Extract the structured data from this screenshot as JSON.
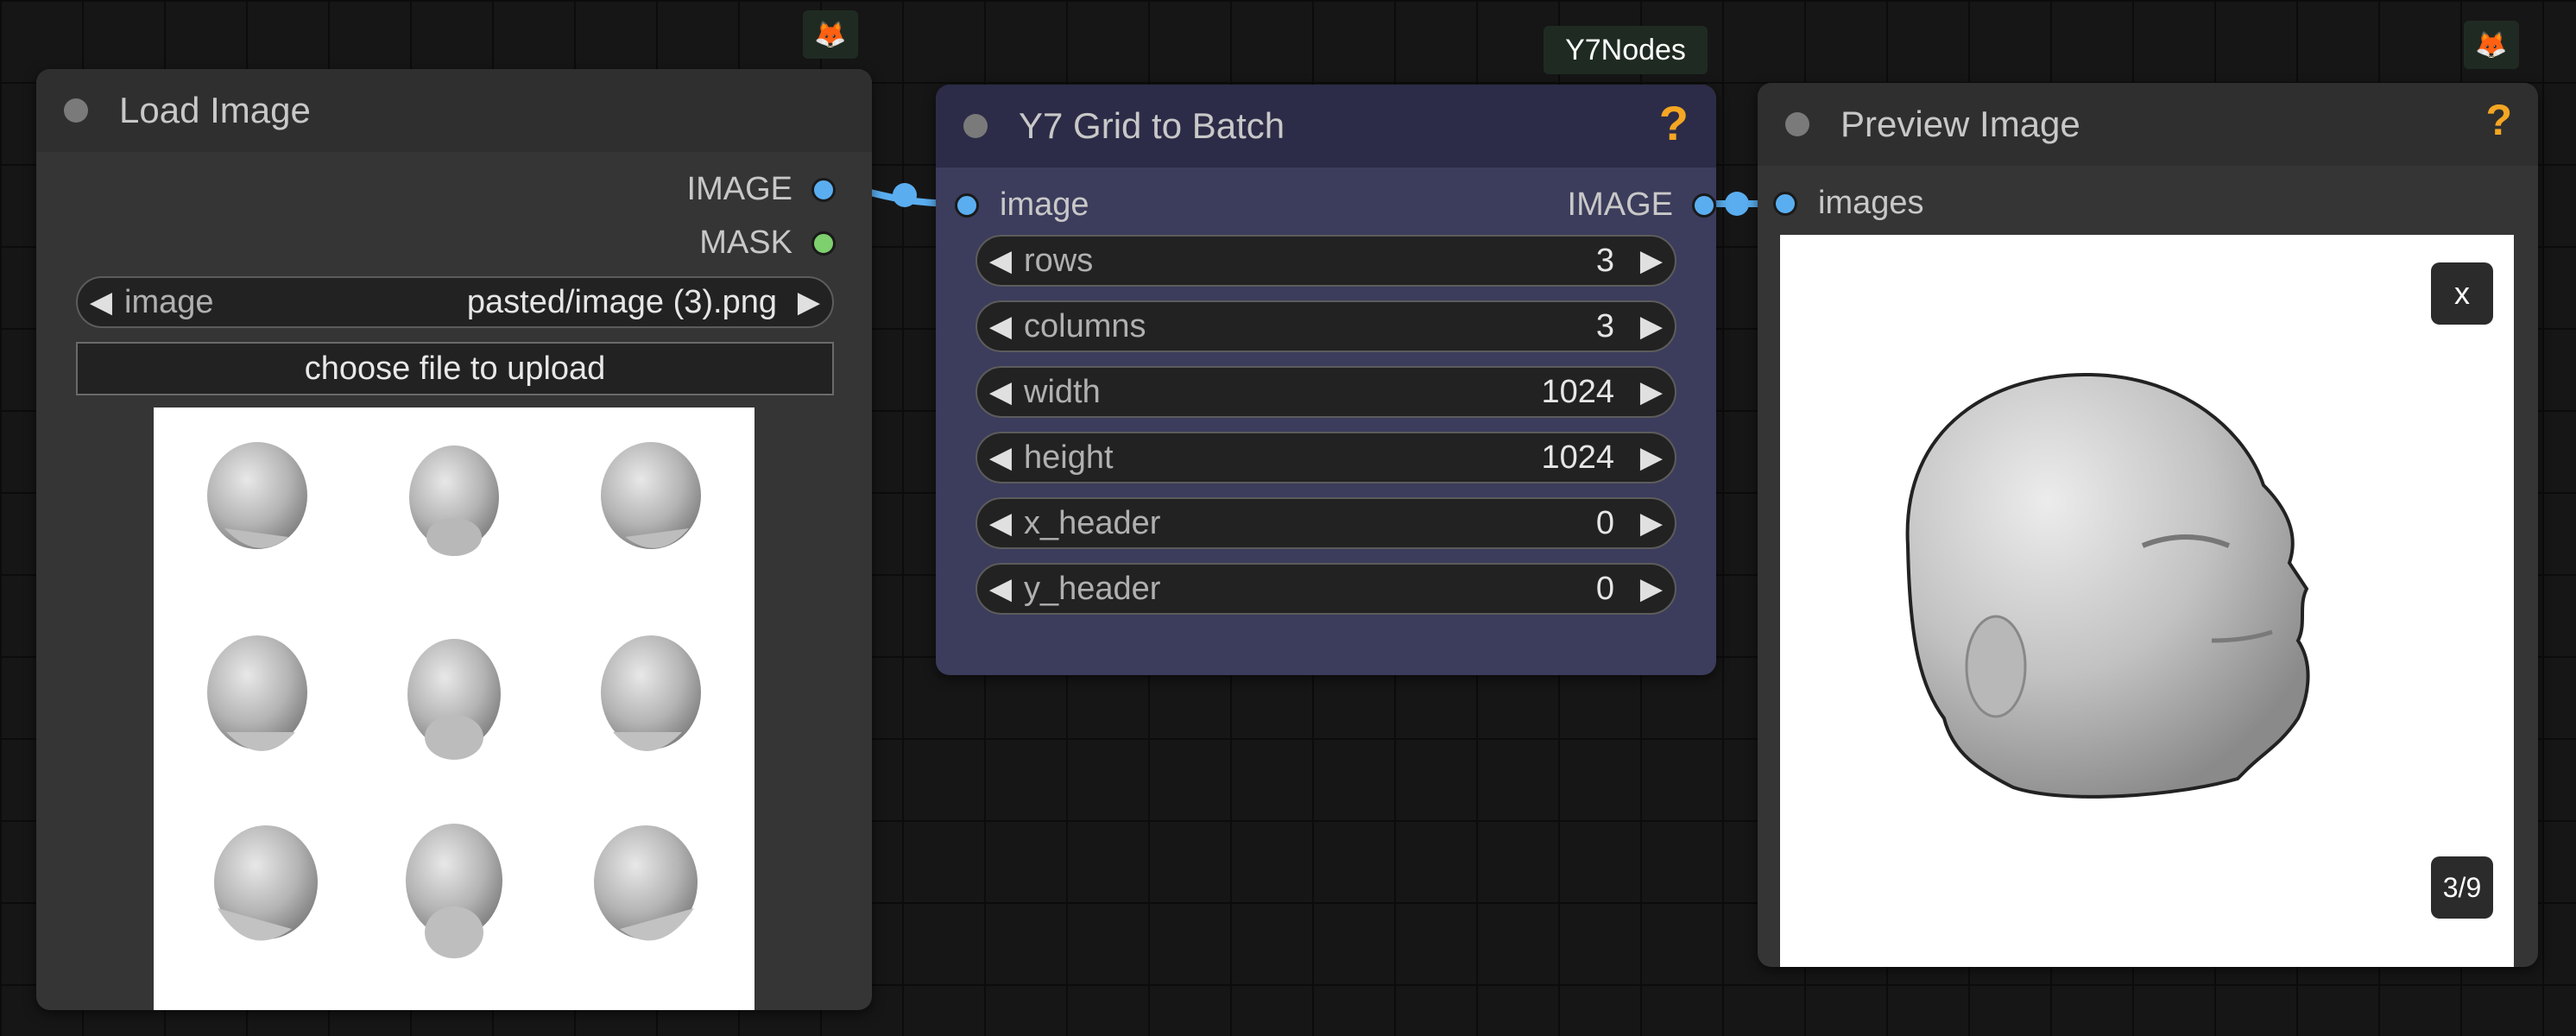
{
  "badges": {
    "fox_icon": "fox-icon",
    "group_label": "Y7Nodes"
  },
  "load_image": {
    "title": "Load Image",
    "outputs": [
      "IMAGE",
      "MASK"
    ],
    "image_widget": {
      "label": "image",
      "value": "pasted/image (3).png"
    },
    "upload_label": "choose file to upload"
  },
  "grid_to_batch": {
    "title": "Y7 Grid to Batch",
    "help": "?",
    "input_label": "image",
    "output_label": "IMAGE",
    "widgets": [
      {
        "label": "rows",
        "value": "3"
      },
      {
        "label": "columns",
        "value": "3"
      },
      {
        "label": "width",
        "value": "1024"
      },
      {
        "label": "height",
        "value": "1024"
      },
      {
        "label": "x_header",
        "value": "0"
      },
      {
        "label": "y_header",
        "value": "0"
      }
    ]
  },
  "preview_image": {
    "title": "Preview Image",
    "help": "?",
    "input_label": "images",
    "close_label": "x",
    "counter": "3/9"
  },
  "colors": {
    "accent_link": "#5aaef0",
    "mask_port": "#7ecf6e",
    "help": "#f5a623",
    "y7_node_bg": "#3c3c5c"
  }
}
